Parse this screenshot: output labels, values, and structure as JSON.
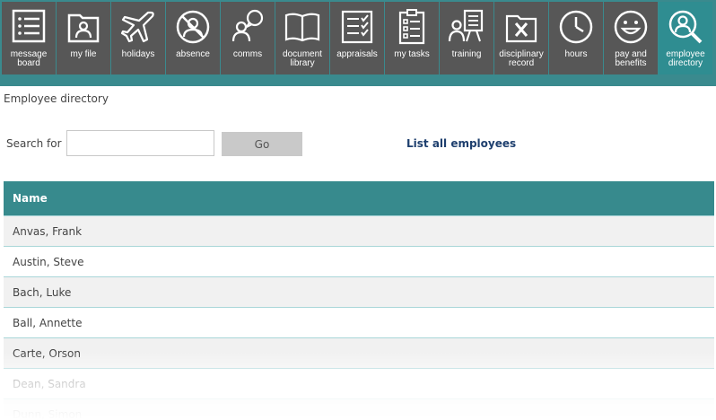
{
  "nav": {
    "items": [
      {
        "label": "message\nboard",
        "icon": "message-board-icon"
      },
      {
        "label": "my file",
        "icon": "my-file-icon"
      },
      {
        "label": "holidays",
        "icon": "airplane-icon"
      },
      {
        "label": "absence",
        "icon": "absence-icon"
      },
      {
        "label": "comms",
        "icon": "comms-icon"
      },
      {
        "label": "document\nlibrary",
        "icon": "book-icon"
      },
      {
        "label": "appraisals",
        "icon": "appraisals-icon"
      },
      {
        "label": "my tasks",
        "icon": "clipboard-icon"
      },
      {
        "label": "training",
        "icon": "training-icon"
      },
      {
        "label": "disciplinary\nrecord",
        "icon": "disciplinary-icon"
      },
      {
        "label": "hours",
        "icon": "clock-icon"
      },
      {
        "label": "pay and\nbenefits",
        "icon": "smiley-icon"
      },
      {
        "label": "employee\ndirectory",
        "icon": "person-search-icon"
      }
    ],
    "active_index": 12
  },
  "breadcrumb": "Employee directory",
  "search": {
    "label": "Search for",
    "value": "",
    "button_label": "Go",
    "list_all_label": "List all employees"
  },
  "table": {
    "header": "Name",
    "rows": [
      "Anvas, Frank",
      "Austin, Steve",
      "Bach, Luke",
      "Ball, Annette",
      "Carte, Orson",
      "Dean, Sandra",
      "Dunn, Simon"
    ]
  },
  "colors": {
    "nav_tile": "#575757",
    "nav_active": "#2f8d91",
    "teal": "#378a8d",
    "link": "#1e3f6e"
  }
}
